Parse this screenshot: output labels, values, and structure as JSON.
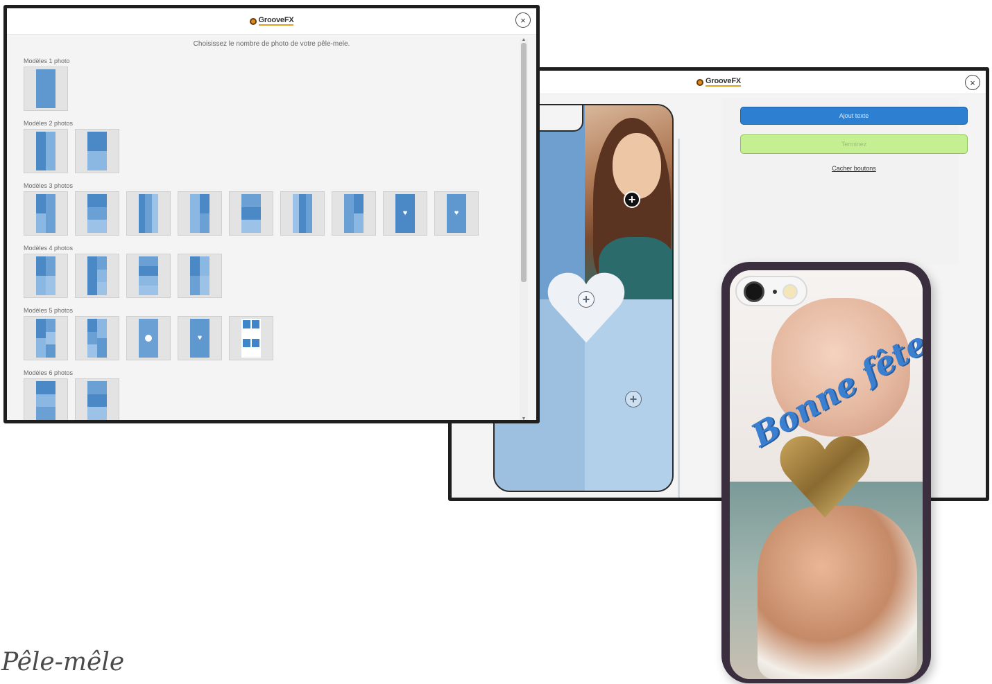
{
  "chooser": {
    "brand": "GrooveFX",
    "close_icon": "×",
    "instruction": "Choisissez le nombre de photo de votre pêle-mele.",
    "sections": [
      {
        "label": "Modèles 1 photo"
      },
      {
        "label": "Modèles 2 photos"
      },
      {
        "label": "Modèles 3 photos"
      },
      {
        "label": "Modèles 4 photos"
      },
      {
        "label": "Modèles 5 photos"
      },
      {
        "label": "Modèles 6 photos"
      }
    ]
  },
  "editor": {
    "brand": "GrooveFX",
    "close_icon": "×",
    "add_text_label": "Ajout texte",
    "finish_label": "Terminez",
    "hide_buttons_label": "Cacher boutons",
    "plus_icon": "+"
  },
  "phone": {
    "overlay_text": "Bonne fête"
  },
  "caption": "Pêle-mêle",
  "colors": {
    "accent_blue": "#2d7fd1",
    "finish_green": "#c4ef92",
    "template_blue": "#6aa0d4"
  }
}
